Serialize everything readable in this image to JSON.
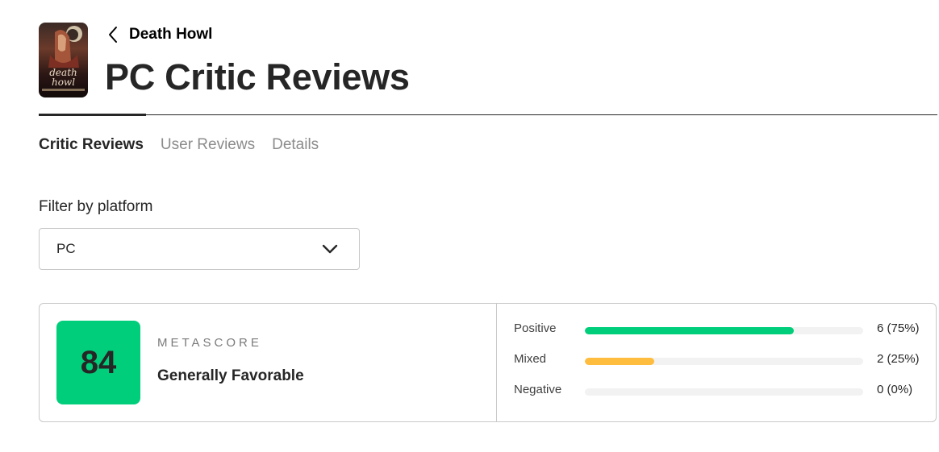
{
  "header": {
    "game_title": "Death Howl",
    "page_title": "PC Critic Reviews",
    "cover_art_text": "death howl",
    "back_icon": "chevron-left-icon"
  },
  "tabs": [
    {
      "label": "Critic Reviews",
      "active": true
    },
    {
      "label": "User Reviews",
      "active": false
    },
    {
      "label": "Details",
      "active": false
    }
  ],
  "filter": {
    "label": "Filter by platform",
    "selected": "PC",
    "icon": "chevron-down-icon"
  },
  "score": {
    "value": "84",
    "label": "METASCORE",
    "verdict": "Generally Favorable",
    "color": "#00ce7a"
  },
  "distribution": [
    {
      "label": "Positive",
      "count": "6 (75%)",
      "fraction": 0.75,
      "color": "#00ce7a"
    },
    {
      "label": "Mixed",
      "count": "2 (25%)",
      "fraction": 0.25,
      "color": "#ffbd3f"
    },
    {
      "label": "Negative",
      "count": "0 (0%)",
      "fraction": 0,
      "color": "#ff6874"
    }
  ]
}
